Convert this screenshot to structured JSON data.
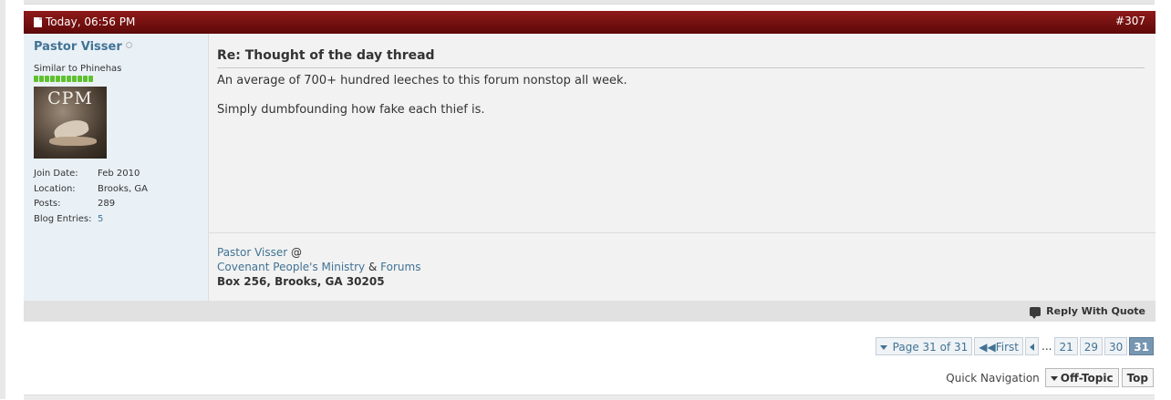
{
  "post": {
    "date": "Today, 06:56 PM",
    "number": "#307",
    "title": "Re: Thought of the day thread",
    "body": [
      "An average of 700+ hundred leeches to this forum nonstop all week.",
      "Simply dumbfounding how fake each thief is."
    ]
  },
  "user": {
    "name": "Pastor Visser",
    "title": "Similar to Phinehas",
    "avatar_text": "CPM",
    "reputation_pips": 11,
    "details": [
      {
        "key": "Join Date:",
        "value": "Feb 2010"
      },
      {
        "key": "Location:",
        "value": "Brooks, GA"
      },
      {
        "key": "Posts:",
        "value": "289"
      },
      {
        "key": "Blog Entries:",
        "value": "5"
      }
    ]
  },
  "signature": {
    "name_link": "Pastor Visser",
    "at": "@",
    "ministry_link": "Covenant People's Ministry",
    "amp": "&",
    "forums_link": "Forums",
    "address": "Box 256, Brooks, GA 30205"
  },
  "actions": {
    "reply_with_quote": "Reply With Quote"
  },
  "pagination": {
    "page_info": "Page 31 of 31",
    "first": "First",
    "ellipsis": "...",
    "pages": [
      "21",
      "29",
      "30"
    ],
    "current": "31"
  },
  "quick_nav": {
    "label": "Quick Navigation",
    "forum": "Off-Topic",
    "top": "Top"
  },
  "colors": {
    "header": "#7a1212",
    "link": "#417394",
    "current_page": "#7696b1",
    "reputation": "#5ec12f"
  }
}
